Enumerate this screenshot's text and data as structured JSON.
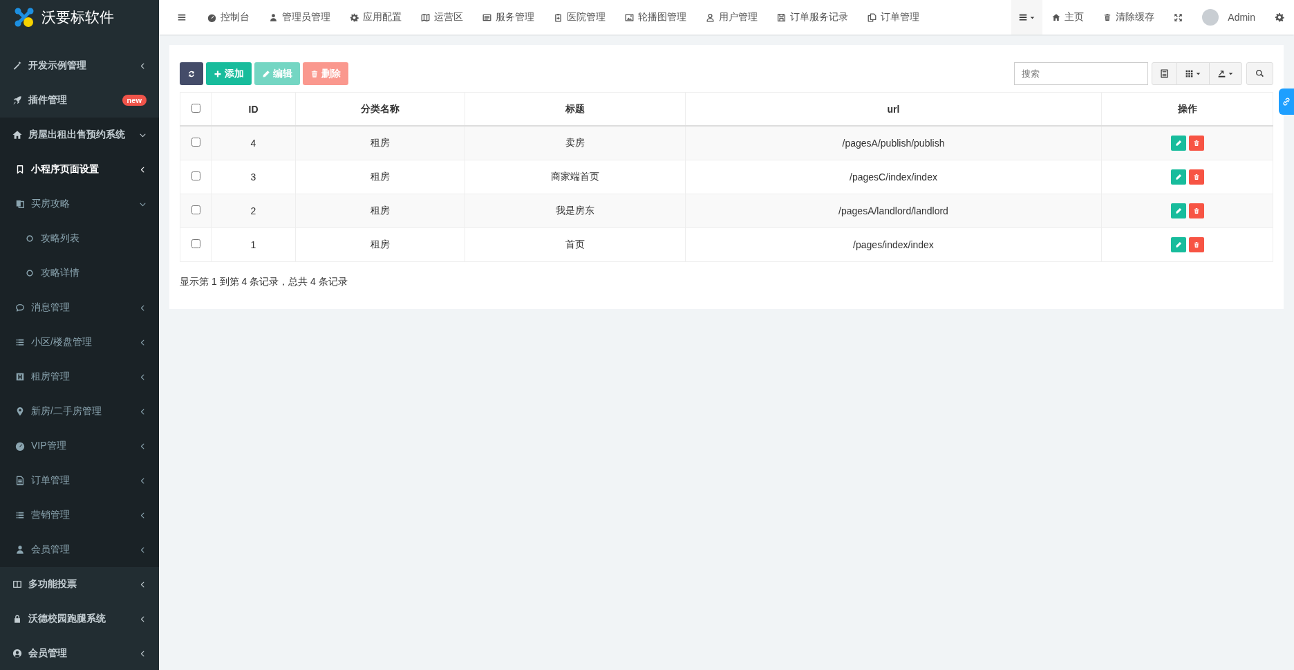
{
  "brand": {
    "name": "沃要标软件"
  },
  "sidebar": {
    "items": [
      {
        "label": "开发示例管理",
        "expanded": false,
        "selected": false
      },
      {
        "label": "插件管理",
        "badge": "new",
        "selected": false
      },
      {
        "label": "房屋出租出售预约系统",
        "expanded": true,
        "selected": false,
        "children": [
          {
            "label": "小程序页面设置",
            "expanded": false,
            "selected": true
          },
          {
            "label": "买房攻略",
            "expanded": true,
            "selected": false,
            "children": [
              {
                "label": "攻略列表",
                "selected": false
              },
              {
                "label": "攻略详情",
                "selected": false
              }
            ]
          },
          {
            "label": "消息管理",
            "expanded": false,
            "selected": false
          },
          {
            "label": "小区/楼盘管理",
            "expanded": false,
            "selected": false
          },
          {
            "label": "租房管理",
            "expanded": false,
            "selected": false
          },
          {
            "label": "新房/二手房管理",
            "expanded": false,
            "selected": false
          },
          {
            "label": "VIP管理",
            "expanded": false,
            "selected": false
          },
          {
            "label": "订单管理",
            "expanded": false,
            "selected": false
          },
          {
            "label": "营销管理",
            "expanded": false,
            "selected": false
          },
          {
            "label": "会员管理",
            "expanded": false,
            "selected": false
          }
        ]
      },
      {
        "label": "多功能投票",
        "expanded": false,
        "selected": false
      },
      {
        "label": "沃德校园跑腿系统",
        "expanded": false,
        "selected": false
      },
      {
        "label": "会员管理",
        "expanded": false,
        "selected": false
      }
    ]
  },
  "nav": {
    "items": [
      {
        "label": "控制台"
      },
      {
        "label": "管理员管理"
      },
      {
        "label": "应用配置"
      },
      {
        "label": "运营区"
      },
      {
        "label": "服务管理"
      },
      {
        "label": "医院管理"
      },
      {
        "label": "轮播图管理"
      },
      {
        "label": "用户管理"
      },
      {
        "label": "订单服务记录"
      },
      {
        "label": "订单管理"
      }
    ],
    "home": "主页",
    "clear_cache": "清除缓存",
    "user": "Admin"
  },
  "toolbar": {
    "buttons": [
      {
        "kind": "refresh",
        "disabled": false
      },
      {
        "kind": "add",
        "label": "添加",
        "disabled": false
      },
      {
        "kind": "edit",
        "label": "编辑",
        "disabled": true
      },
      {
        "kind": "delete",
        "label": "删除",
        "disabled": true
      }
    ],
    "search": {
      "placeholder": "搜索"
    }
  },
  "table": {
    "header_checked": false,
    "columns": [
      "ID",
      "分类名称",
      "标题",
      "url",
      "操作"
    ],
    "rows": [
      {
        "checked": false,
        "cells": [
          "4",
          "租房",
          "卖房",
          "/pagesA/publish/publish"
        ]
      },
      {
        "checked": false,
        "cells": [
          "3",
          "租房",
          "商家端首页",
          "/pagesC/index/index"
        ]
      },
      {
        "checked": false,
        "cells": [
          "2",
          "租房",
          "我是房东",
          "/pagesA/landlord/landlord"
        ]
      },
      {
        "checked": false,
        "cells": [
          "1",
          "租房",
          "首页",
          "/pages/index/index"
        ]
      }
    ]
  },
  "footer": "显示第 1 到第 4 条记录，总共 4 条记录"
}
